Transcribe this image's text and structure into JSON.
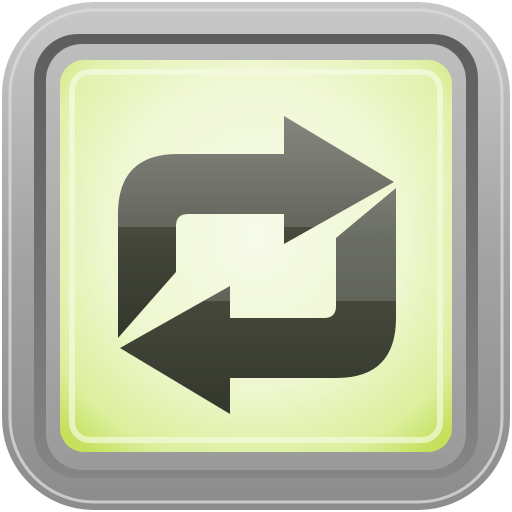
{
  "app_icon": {
    "icon_name": "repeat-arrows-icon",
    "colors": {
      "frame_outer": "#a6a6a6",
      "frame_inner": "#6b6b6b",
      "screen_light": "#f6fbe6",
      "screen_mid": "#e4f3b8",
      "screen_edge": "#c9e36d",
      "arrow_top": "#686b61",
      "arrow_bottom": "#3c3f33"
    }
  }
}
